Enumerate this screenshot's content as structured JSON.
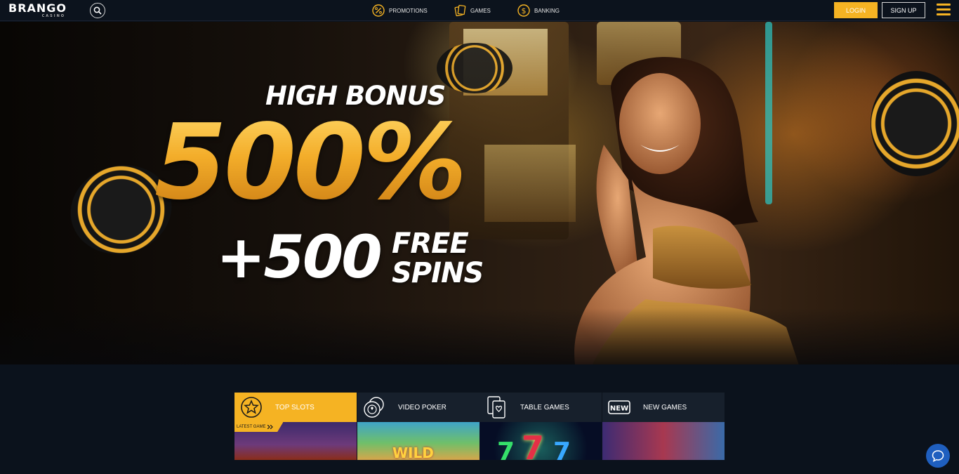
{
  "header": {
    "logo_text": "BRANGO",
    "logo_sub": "CASINO",
    "nav": [
      {
        "label": "PROMOTIONS",
        "icon": "percent-icon"
      },
      {
        "label": "GAMES",
        "icon": "cards-icon"
      },
      {
        "label": "BANKING",
        "icon": "dollar-icon"
      }
    ],
    "login_label": "LOGIN",
    "signup_label": "SIGN UP",
    "accent_color": "#f5b323"
  },
  "hero": {
    "title": "HIGH BONUS",
    "percent": "500%",
    "plus_amount": "+500",
    "spins_line1": "FREE",
    "spins_line2": "SPINS"
  },
  "categories": [
    {
      "label": "TOP SLOTS",
      "icon": "star-icon",
      "active": true
    },
    {
      "label": "VIDEO POKER",
      "icon": "chips-icon",
      "active": false
    },
    {
      "label": "TABLE GAMES",
      "icon": "playing-cards-icon",
      "active": false
    },
    {
      "label": "NEW GAMES",
      "icon": "new-badge-icon",
      "active": false
    }
  ],
  "latest_badge": "LATEST GAME",
  "new_icon_text": "NEW",
  "tile_texts": {
    "wild": "WILD",
    "seven": "7"
  }
}
